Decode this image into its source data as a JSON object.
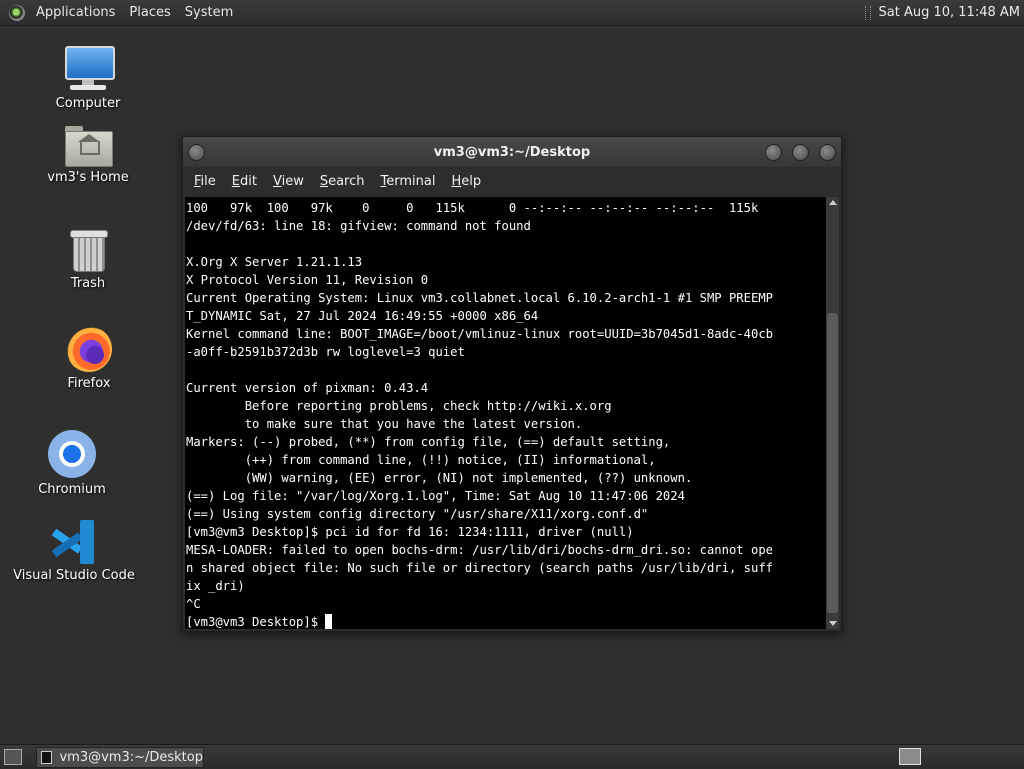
{
  "top_panel": {
    "menus": [
      "Applications",
      "Places",
      "System"
    ],
    "clock": "Sat Aug 10, 11:48 AM"
  },
  "desktop": {
    "icons": [
      {
        "label": "Computer",
        "icon": "computer-icon"
      },
      {
        "label": "vm3's Home",
        "icon": "home-folder-icon"
      },
      {
        "label": "Trash",
        "icon": "trash-icon"
      },
      {
        "label": "Firefox",
        "icon": "firefox-icon"
      },
      {
        "label": "Chromium",
        "icon": "chromium-icon"
      },
      {
        "label": "Visual Studio Code",
        "icon": "vscode-icon"
      }
    ]
  },
  "terminal": {
    "title": "vm3@vm3:~/Desktop",
    "menu": [
      {
        "u": "F",
        "rest": "ile"
      },
      {
        "u": "E",
        "rest": "dit"
      },
      {
        "u": "V",
        "rest": "iew"
      },
      {
        "u": "S",
        "rest": "earch"
      },
      {
        "u": "T",
        "rest": "erminal"
      },
      {
        "u": "H",
        "rest": "elp"
      }
    ],
    "lines": [
      "100   97k  100   97k    0     0   115k      0 --:--:-- --:--:-- --:--:--  115k",
      "/dev/fd/63: line 18: gifview: command not found",
      "",
      "X.Org X Server 1.21.1.13",
      "X Protocol Version 11, Revision 0",
      "Current Operating System: Linux vm3.collabnet.local 6.10.2-arch1-1 #1 SMP PREEMP",
      "T_DYNAMIC Sat, 27 Jul 2024 16:49:55 +0000 x86_64",
      "Kernel command line: BOOT_IMAGE=/boot/vmlinuz-linux root=UUID=3b7045d1-8adc-40cb",
      "-a0ff-b2591b372d3b rw loglevel=3 quiet",
      "",
      "Current version of pixman: 0.43.4",
      "        Before reporting problems, check http://wiki.x.org",
      "        to make sure that you have the latest version.",
      "Markers: (--) probed, (**) from config file, (==) default setting,",
      "        (++) from command line, (!!) notice, (II) informational,",
      "        (WW) warning, (EE) error, (NI) not implemented, (??) unknown.",
      "(==) Log file: \"/var/log/Xorg.1.log\", Time: Sat Aug 10 11:47:06 2024",
      "(==) Using system config directory \"/usr/share/X11/xorg.conf.d\"",
      "[vm3@vm3 Desktop]$ pci id for fd 16: 1234:1111, driver (null)",
      "MESA-LOADER: failed to open bochs-drm: /usr/lib/dri/bochs-drm_dri.so: cannot ope",
      "n shared object file: No such file or directory (search paths /usr/lib/dri, suff",
      "ix _dri)",
      "^C"
    ],
    "prompt": "[vm3@vm3 Desktop]$ "
  },
  "taskbar": {
    "window_button": "vm3@vm3:~/Desktop"
  }
}
